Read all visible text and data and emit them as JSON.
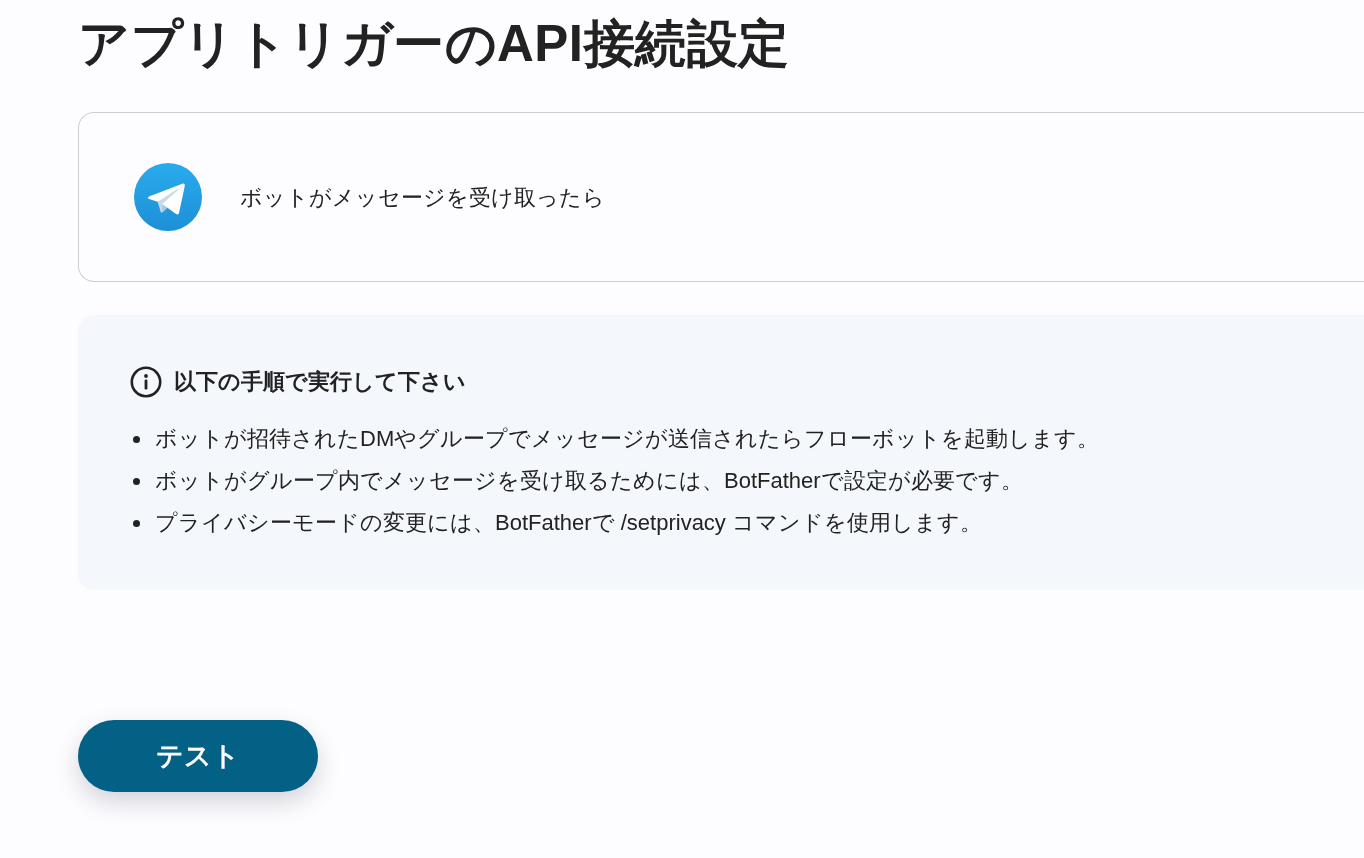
{
  "page_title": "アプリトリガーのAPI接続設定",
  "trigger": {
    "label": "ボットがメッセージを受け取ったら"
  },
  "info": {
    "heading": "以下の手順で実行して下さい",
    "items": [
      "ボットが招待されたDMやグループでメッセージが送信されたらフローボットを起動します。",
      "ボットがグループ内でメッセージを受け取るためには、BotFatherで設定が必要です。",
      "プライバシーモードの変更には、BotFatherで /setprivacy コマンドを使用します。"
    ]
  },
  "buttons": [
    {
      "label": "テスト"
    }
  ]
}
